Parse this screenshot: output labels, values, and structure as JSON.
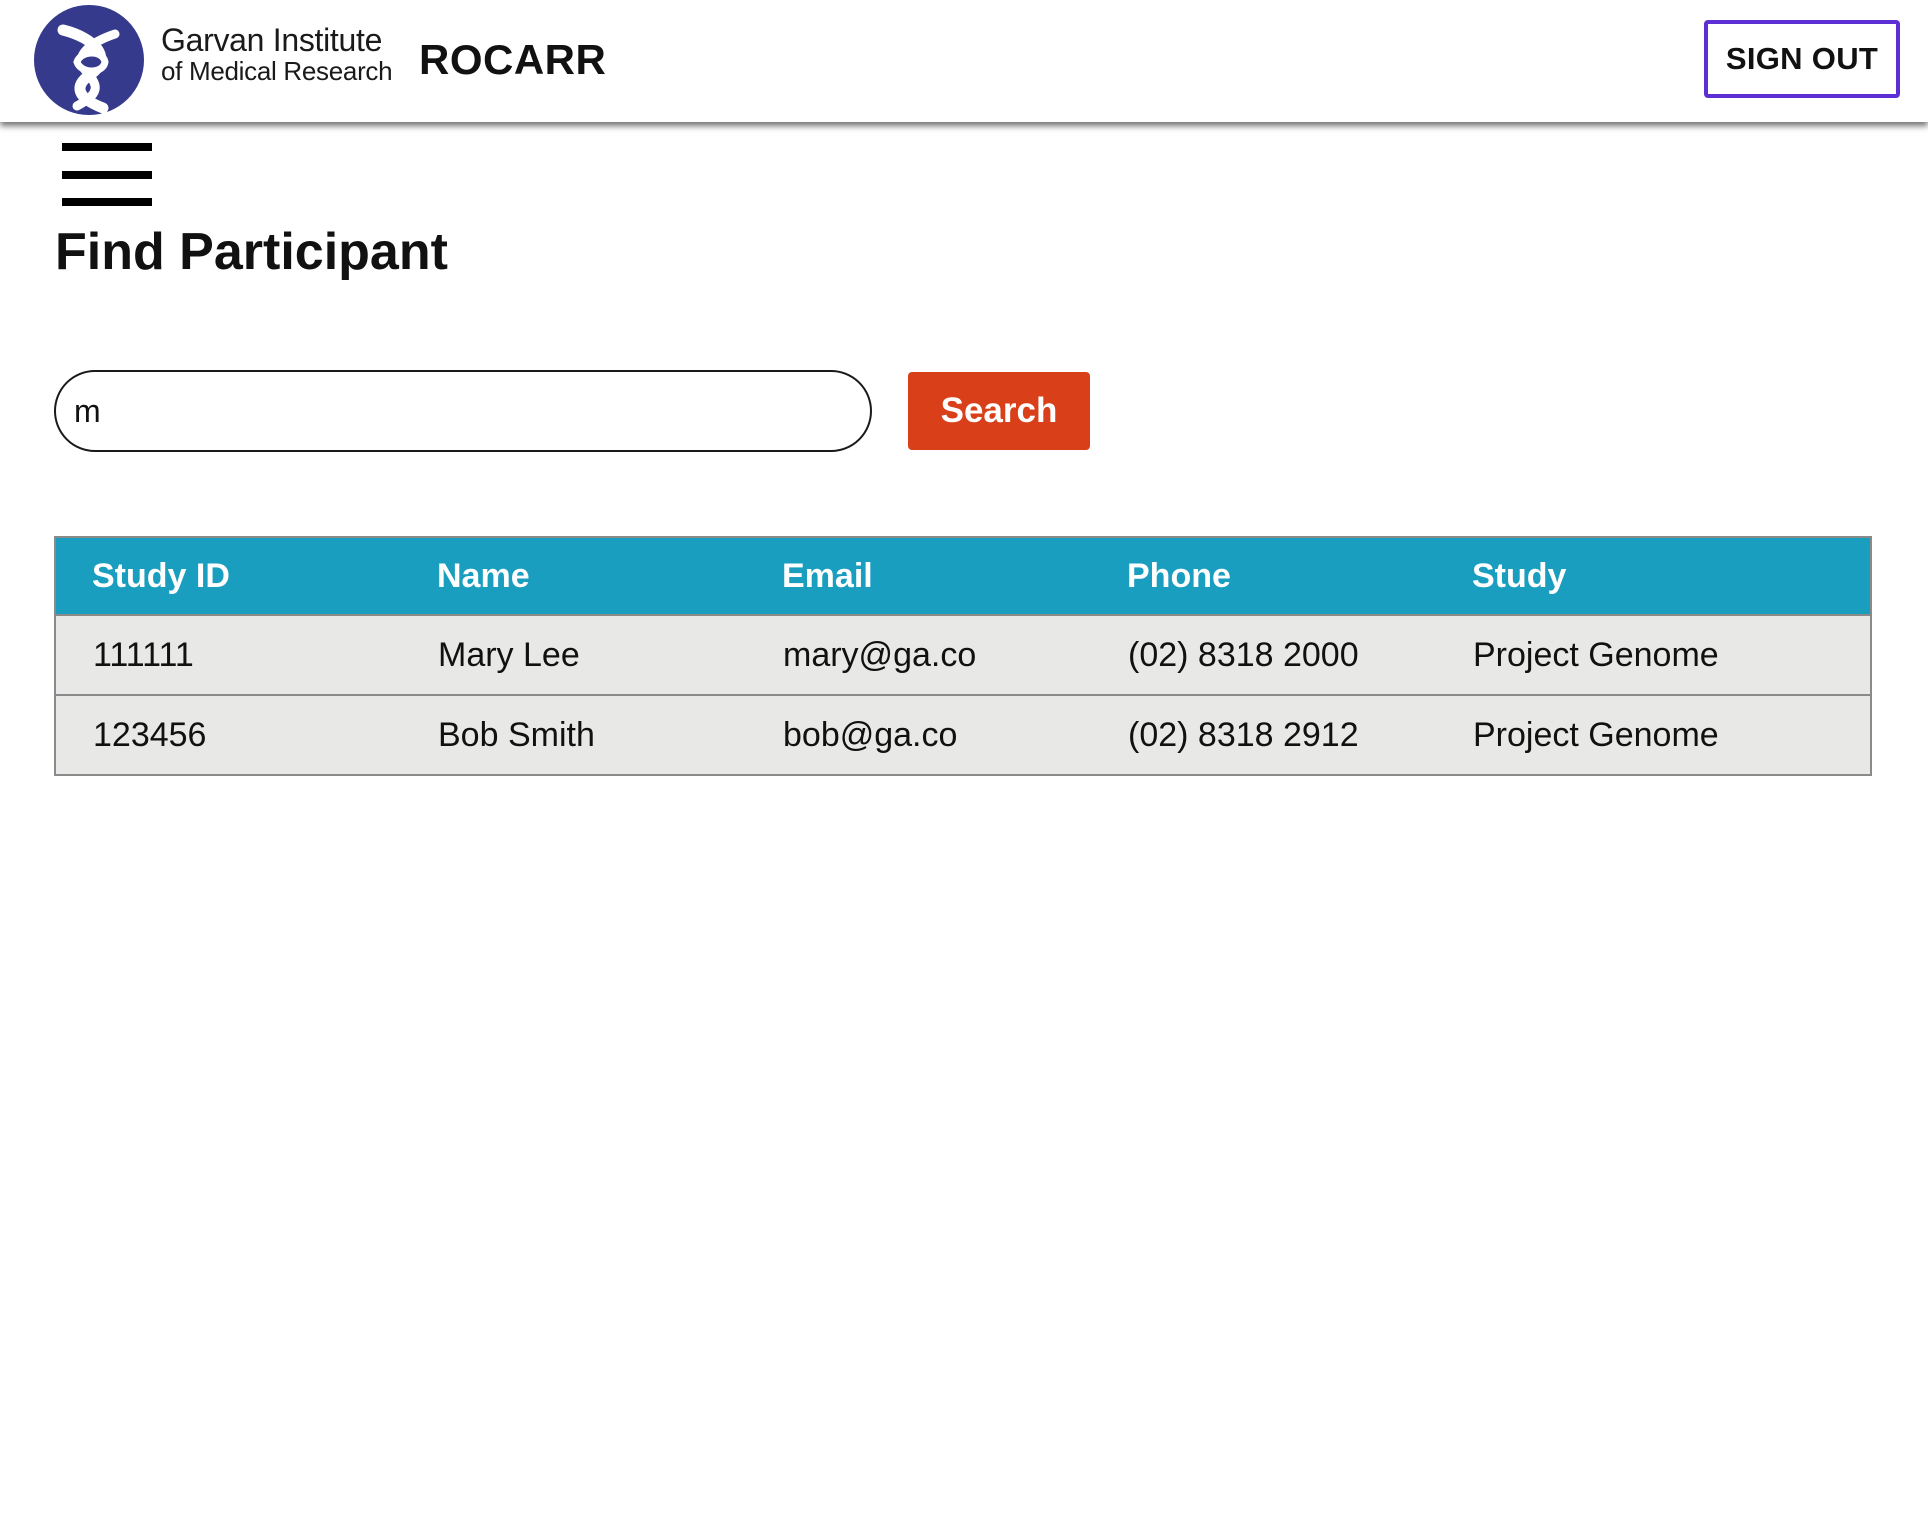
{
  "header": {
    "logo_line1": "Garvan Institute",
    "logo_line2": "of Medical Research",
    "app_title": "ROCARR",
    "sign_out_label": "SIGN OUT",
    "logo_color": "#353a8c",
    "sign_out_border_color": "#5b2fd4"
  },
  "page": {
    "menu_icon": "hamburger-menu-icon",
    "title": "Find Participant"
  },
  "search": {
    "value": "m",
    "button_label": "Search",
    "button_color": "#d9401a"
  },
  "table": {
    "header_color": "#1a9ec0",
    "columns": [
      "Study ID",
      "Name",
      "Email",
      "Phone",
      "Study"
    ],
    "rows": [
      [
        "111111",
        "Mary Lee",
        "mary@ga.co",
        "(02) 8318 2000",
        "Project Genome"
      ],
      [
        "123456",
        "Bob Smith",
        "bob@ga.co",
        "(02) 8318 2912",
        "Project Genome"
      ]
    ]
  }
}
